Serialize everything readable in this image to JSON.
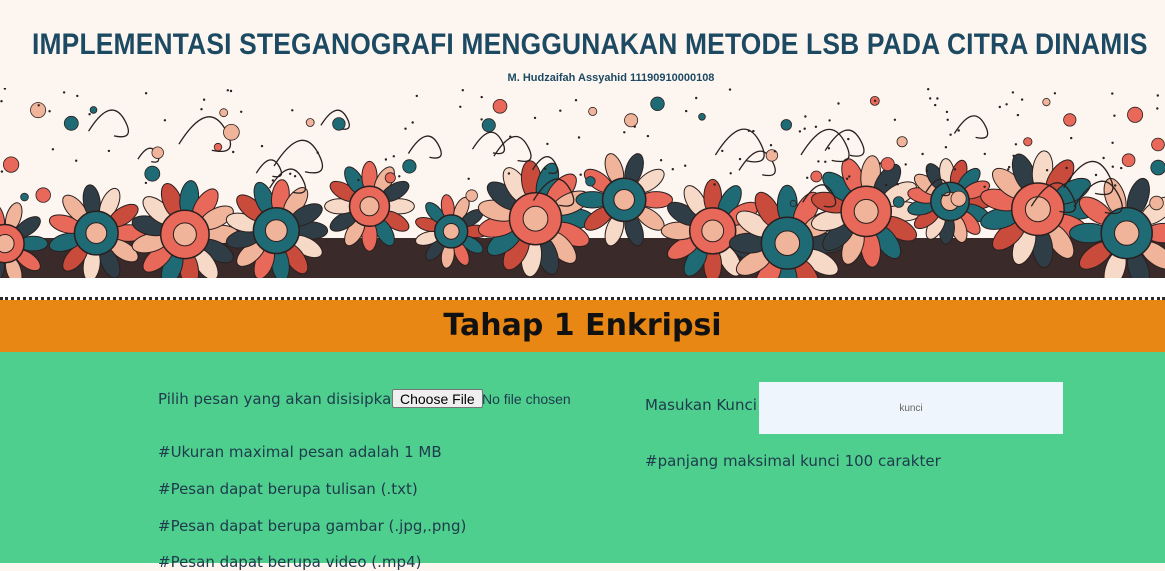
{
  "header": {
    "title": "IMPLEMENTASI STEGANOGRAFI MENGGUNAKAN METODE LSB PADA CITRA DINAMIS",
    "author": "M. Hudzaifah Assyahid 11190910000108",
    "banner": "mandala-floral-banner"
  },
  "step": {
    "title": "Tahap 1 Enkripsi"
  },
  "left": {
    "file_label": "Pilih pesan yang akan disisipkan :",
    "file_button": "Choose File",
    "file_status": "No file chosen",
    "notes": [
      "#Ukuran maximal pesan adalah 1 MB",
      "#Pesan dapat berupa tulisan (.txt)",
      "#Pesan dapat berupa gambar (.jpg,.png)",
      "#Pesan dapat berupa video (.mp4)"
    ]
  },
  "right": {
    "key_label": "Masukan Kunci :",
    "key_placeholder": "kunci",
    "key_value": "",
    "key_note": "#panjang maksimal kunci 100 carakter"
  },
  "colors": {
    "band": "#e88714",
    "content": "#4fcf8e",
    "title": "#1d4a63",
    "teal": "#1e6b75",
    "coral": "#e8685a",
    "peach": "#efb499"
  }
}
